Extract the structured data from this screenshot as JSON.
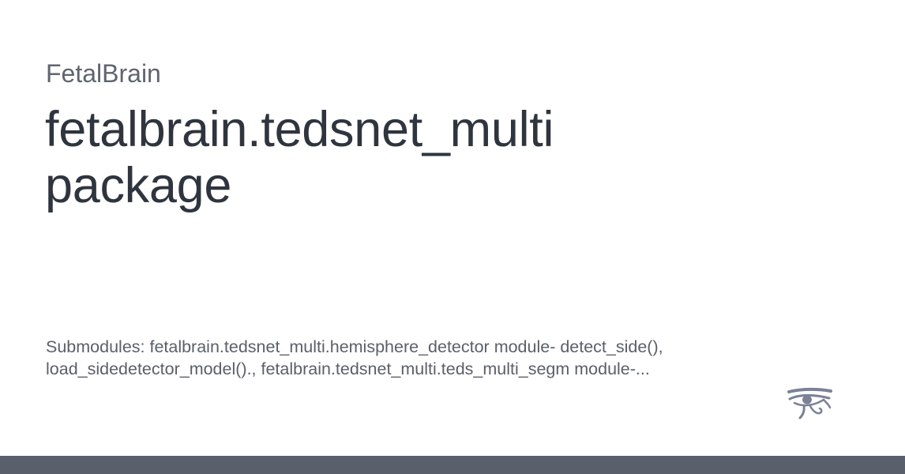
{
  "site": {
    "name": "FetalBrain"
  },
  "page": {
    "title": "fetalbrain.tedsnet_multi package",
    "description": "Submodules: fetalbrain.tedsnet_multi.hemisphere_detector module- detect_side(), load_sidedetector_model()., fetalbrain.tedsnet_multi.teds_multi_segm module-..."
  },
  "logo": {
    "icon": "eye-of-horus-icon",
    "color": "#7b8297"
  },
  "colors": {
    "title": "#2f353e",
    "muted": "#5f6570",
    "footer": "#5a606b",
    "background": "#ffffff"
  }
}
